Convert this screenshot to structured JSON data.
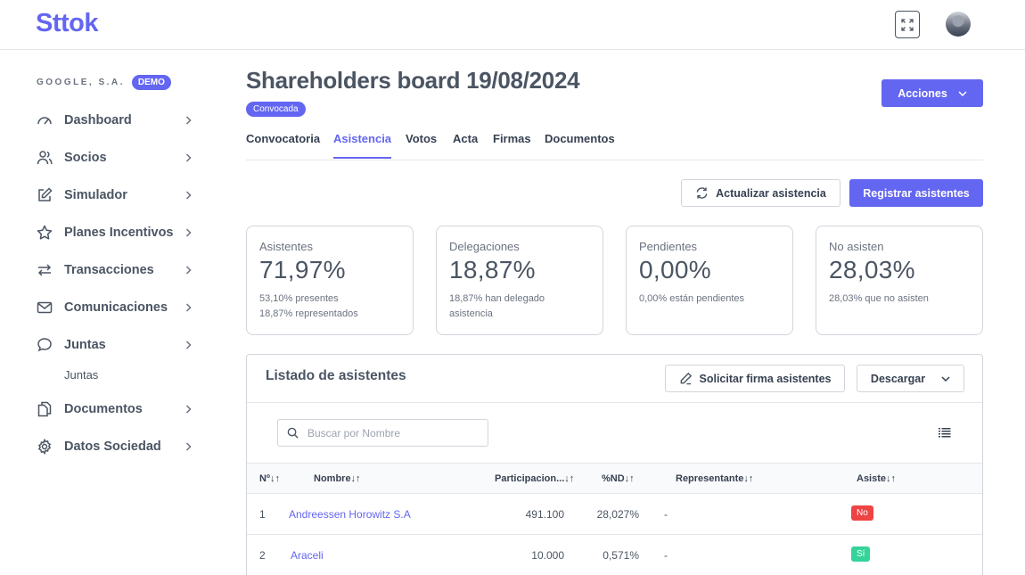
{
  "app": {
    "logo": "Sttok"
  },
  "sidebar": {
    "company": "GOOGLE, S.A.",
    "badge": "DEMO",
    "items": [
      {
        "label": "Dashboard",
        "icon": "gauge-icon"
      },
      {
        "label": "Socios",
        "icon": "users-icon"
      },
      {
        "label": "Simulador",
        "icon": "edit-icon"
      },
      {
        "label": "Planes Incentivos",
        "icon": "star-icon"
      },
      {
        "label": "Transacciones",
        "icon": "arrows-icon"
      },
      {
        "label": "Comunicaciones",
        "icon": "mail-icon"
      },
      {
        "label": "Juntas",
        "icon": "chat-icon"
      },
      {
        "label": "Documentos",
        "icon": "documents-icon"
      },
      {
        "label": "Datos Sociedad",
        "icon": "gear-icon"
      }
    ],
    "sub_item": "Juntas"
  },
  "header": {
    "title": "Shareholders board 19/08/2024",
    "status": "Convocada",
    "actions_label": "Acciones"
  },
  "tabs": [
    {
      "label": "Convocatoria"
    },
    {
      "label": "Asistencia",
      "active": true
    },
    {
      "label": "Votos"
    },
    {
      "label": "Acta"
    },
    {
      "label": "Firmas"
    },
    {
      "label": "Documentos"
    }
  ],
  "toolbar": {
    "refresh_label": "Actualizar asistencia",
    "register_label": "Registrar asistentes"
  },
  "cards": [
    {
      "label": "Asistentes",
      "value": "71,97%",
      "notes": [
        "53,10% presentes",
        "18,87% representados"
      ]
    },
    {
      "label": "Delegaciones",
      "value": "18,87%",
      "notes": [
        "18,87% han delegado asistencia"
      ]
    },
    {
      "label": "Pendientes",
      "value": "0,00%",
      "notes": [
        "0,00% están pendientes"
      ]
    },
    {
      "label": "No asisten",
      "value": "28,03%",
      "notes": [
        "28,03% que no asisten"
      ]
    }
  ],
  "list": {
    "title": "Listado de asistentes",
    "sign_label": "Solicitar firma asistentes",
    "download_label": "Descargar",
    "search_placeholder": "Buscar por Nombre",
    "columns": [
      "Nº↓↑",
      "Nombre↓↑",
      "Participacion...↓↑",
      "%ND↓↑",
      "Representante↓↑",
      "Asiste↓↑"
    ],
    "rows": [
      {
        "n": "1",
        "name": "Andreessen Horowitz S.A",
        "participation": "491.100",
        "nd": "28,027%",
        "rep": "-",
        "attends": "No"
      },
      {
        "n": "2",
        "name": "Araceli",
        "participation": "10.000",
        "nd": "0,571%",
        "rep": "-",
        "attends": "Sí"
      }
    ]
  },
  "colors": {
    "accent": "#6366f1",
    "no": "#ef4444",
    "yes": "#34d399"
  }
}
